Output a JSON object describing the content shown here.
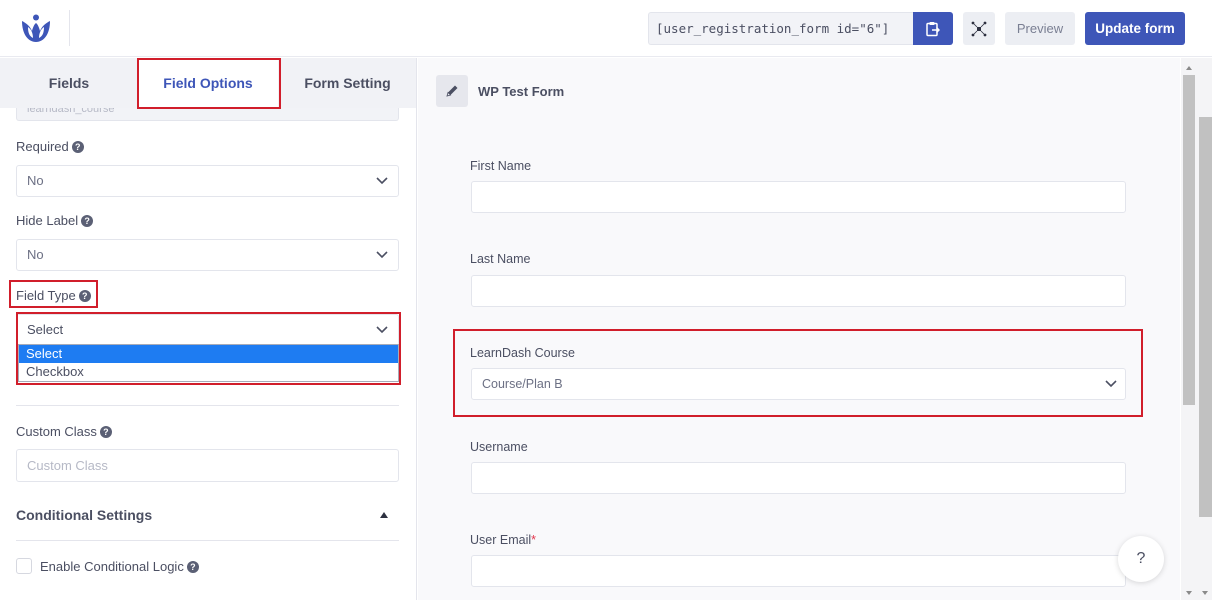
{
  "topbar": {
    "logo_icon": "user-registration-logo",
    "shortcode": "[user_registration_form id=\"6\"]",
    "copy_icon": "clipboard-copy-icon",
    "expand_icon": "fullscreen-expand-icon",
    "preview_label": "Preview",
    "update_label": "Update form"
  },
  "left_panel": {
    "tabs": [
      {
        "label": "Fields",
        "active": false
      },
      {
        "label": "Field Options",
        "active": true
      },
      {
        "label": "Form Setting",
        "active": false
      }
    ],
    "field_name_value": "learndash_course",
    "required": {
      "label": "Required",
      "help_icon": "question-circle-icon",
      "value": "No"
    },
    "hide_label": {
      "label": "Hide Label",
      "help_icon": "question-circle-icon",
      "value": "No"
    },
    "field_type": {
      "label": "Field Type",
      "help_icon": "question-circle-icon",
      "value": "Select",
      "options": [
        {
          "label": "Select",
          "highlighted": true
        },
        {
          "label": "Checkbox",
          "highlighted": false
        }
      ]
    },
    "custom_class": {
      "label": "Custom Class",
      "help_icon": "question-circle-icon",
      "placeholder": "Custom Class",
      "value": ""
    },
    "conditional_settings": {
      "title": "Conditional Settings",
      "expanded": true,
      "toggle_icon": "caret-up-icon"
    },
    "enable_conditional_logic": {
      "label": "Enable Conditional Logic",
      "checked": false,
      "help_icon": "question-circle-icon"
    }
  },
  "right_panel": {
    "edit_icon": "pencil-icon",
    "form_title": "WP Test Form",
    "fields": [
      {
        "label": "First Name",
        "type": "text",
        "value": "",
        "required": false
      },
      {
        "label": "Last Name",
        "type": "text",
        "value": "",
        "required": false
      },
      {
        "label": "LearnDash Course",
        "type": "select",
        "value": "Course/Plan B",
        "required": false
      },
      {
        "label": "Username",
        "type": "text",
        "value": "",
        "required": false
      },
      {
        "label": "User Email",
        "type": "text",
        "value": "",
        "required": true,
        "required_mark": "*"
      }
    ],
    "help_button": "?"
  },
  "colors": {
    "primary": "#3e56b8",
    "highlight_box": "#d11e2b",
    "dropdown_selected": "#1e7cf2",
    "required_mark": "#e2364c"
  }
}
